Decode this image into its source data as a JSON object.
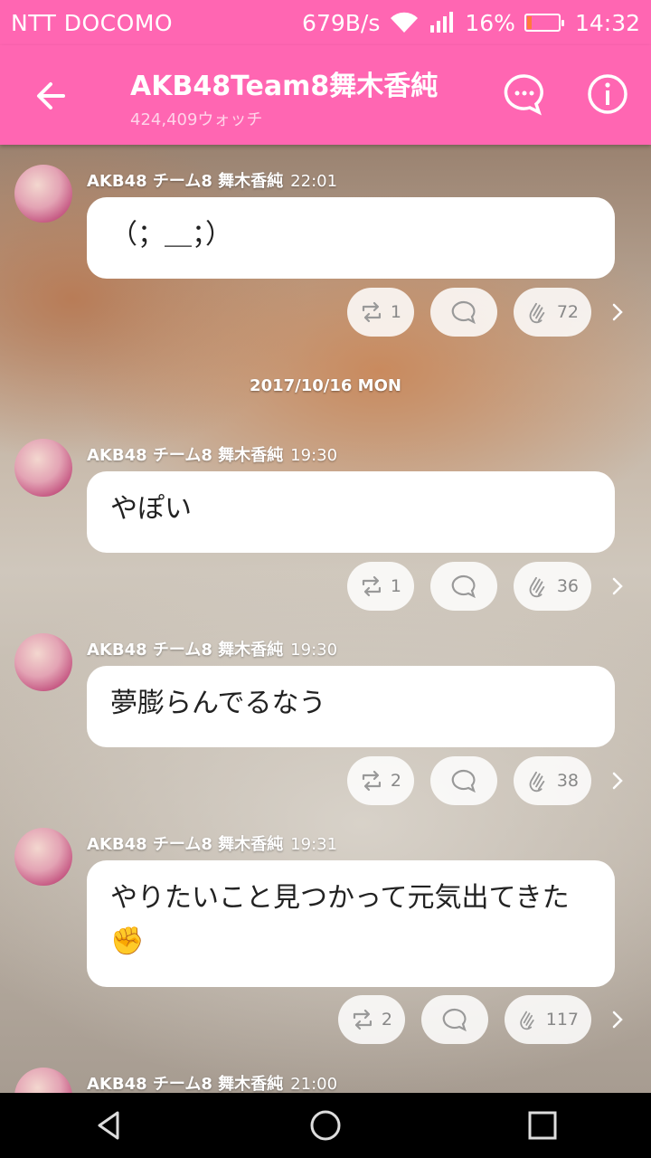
{
  "status_bar": {
    "carrier": "NTT DOCOMO",
    "speed": "679B/s",
    "battery": "16%",
    "battery_fraction": 0.16,
    "time": "14:32"
  },
  "header": {
    "title": "AKB48Team8舞木香純",
    "watchers": "424,409ウォッチ"
  },
  "date_separator": "2017/10/16 MON",
  "messages": [
    {
      "author": "AKB48 チーム8 舞木香純",
      "time": "22:01",
      "text": "（；＿；）",
      "retweets": "1",
      "claps": "72"
    },
    {
      "author": "AKB48 チーム8 舞木香純",
      "time": "19:30",
      "text": "やぽい",
      "retweets": "1",
      "claps": "36"
    },
    {
      "author": "AKB48 チーム8 舞木香純",
      "time": "19:30",
      "text": "夢膨らんでるなう",
      "retweets": "2",
      "claps": "38"
    },
    {
      "author": "AKB48 チーム8 舞木香純",
      "time": "19:31",
      "text": "やりたいこと見つかって元気出てきた✊",
      "retweets": "2",
      "claps": "117"
    },
    {
      "author": "AKB48 チーム8 舞木香純",
      "time": "21:00"
    }
  ],
  "colors": {
    "accent": "#ff66b2"
  }
}
